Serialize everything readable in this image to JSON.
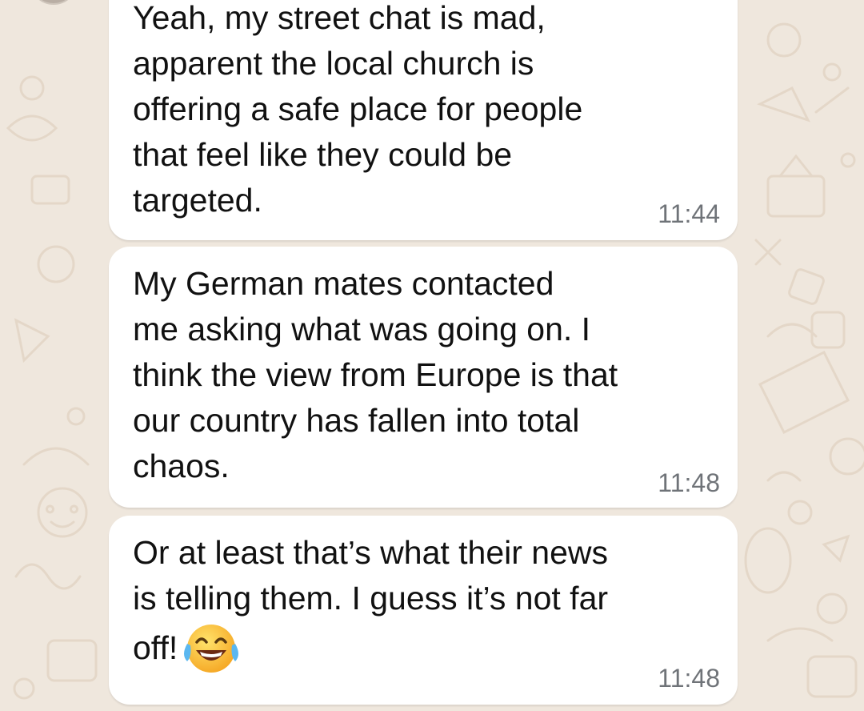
{
  "chat": {
    "messages": [
      {
        "text": "Yeah, my street chat is mad,\napparent the local church is\noffering a safe place for people\nthat feel like they could be\ntargeted.",
        "time": "11:44"
      },
      {
        "text": "My German mates contacted\nme asking what was going on. I\nthink the view from Europe is that\nour country has fallen into total\nchaos.",
        "time": "11:48"
      },
      {
        "text": "Or at least that’s what their news\nis telling them. I guess it’s not far\noff!",
        "time": "11:48",
        "emoji": "face-with-tears-of-joy-icon"
      }
    ]
  },
  "colors": {
    "background": "#efe7dd",
    "bubble": "#ffffff",
    "text": "#111111",
    "timestamp": "#6f7378"
  }
}
